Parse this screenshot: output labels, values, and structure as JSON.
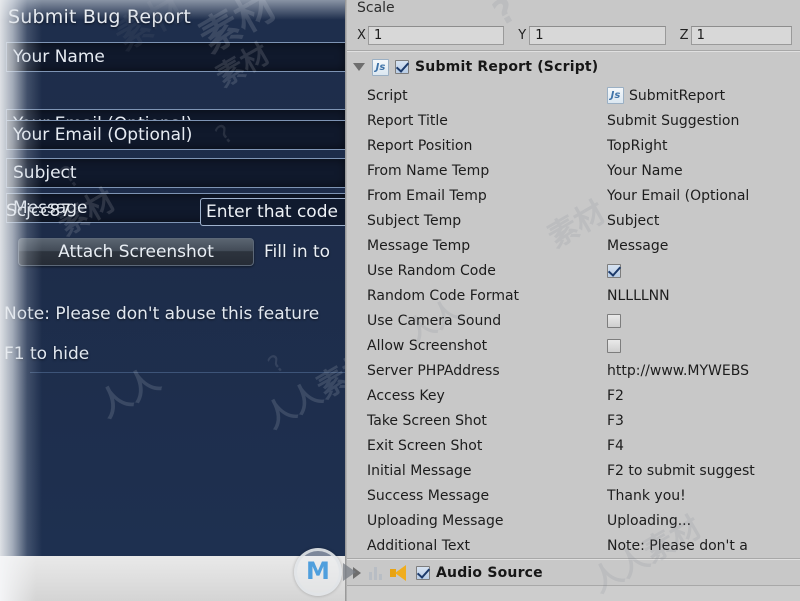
{
  "game_view": {
    "title": "Submit Bug Report",
    "fields": [
      {
        "name": "your-name",
        "value": "Your Name"
      },
      {
        "name": "your-email",
        "value": "Your Email (Optional)"
      },
      {
        "name": "subject",
        "value": "Subject"
      },
      {
        "name": "message",
        "value": "Message"
      }
    ],
    "captcha_code": "Scjcc87",
    "captcha_placeholder": "Enter that code",
    "attach_button": "Attach Screenshot",
    "fill_in_hint": "Fill in to",
    "note": "Note: Please don't abuse this feature",
    "hide_hint": "F1 to hide"
  },
  "inspector": {
    "scale_label": "Scale",
    "scale": {
      "x_axis": "X",
      "x_value": "1",
      "y_axis": "Y",
      "y_value": "1",
      "z_axis": "Z",
      "z_value": "1"
    },
    "component": {
      "icon": "js-script-icon",
      "enabled": true,
      "title": "Submit Report (Script)"
    },
    "properties": [
      {
        "label": "Script",
        "value": "SubmitReport",
        "type": "object",
        "icon": "js-script-icon"
      },
      {
        "label": "Report Title",
        "value": "Submit Suggestion",
        "type": "text"
      },
      {
        "label": "Report Position",
        "value": "TopRight",
        "type": "text"
      },
      {
        "label": "From Name Temp",
        "value": "Your Name",
        "type": "text"
      },
      {
        "label": "From Email Temp",
        "value": "Your Email (Optional",
        "type": "text"
      },
      {
        "label": "Subject Temp",
        "value": "Subject",
        "type": "text"
      },
      {
        "label": "Message Temp",
        "value": "Message",
        "type": "text"
      },
      {
        "label": "Use Random Code",
        "value": "",
        "type": "checkbox",
        "checked": true
      },
      {
        "label": "Random Code Format",
        "value": "NLLLLNN",
        "type": "text"
      },
      {
        "label": "Use Camera Sound",
        "value": "",
        "type": "checkbox",
        "checked": false
      },
      {
        "label": "Allow Screenshot",
        "value": "",
        "type": "checkbox",
        "checked": false
      },
      {
        "label": "Server PHPAddress",
        "value": "http://www.MYWEBS",
        "type": "text"
      },
      {
        "label": "Access Key",
        "value": "F2",
        "type": "text"
      },
      {
        "label": "Take Screen Shot",
        "value": "F3",
        "type": "text"
      },
      {
        "label": "Exit Screen Shot",
        "value": "F4",
        "type": "text"
      },
      {
        "label": "Initial Message",
        "value": "F2 to submit suggest",
        "type": "text"
      },
      {
        "label": "Success Message",
        "value": "Thank you!",
        "type": "text"
      },
      {
        "label": "Uploading Message",
        "value": "Uploading...",
        "type": "text"
      },
      {
        "label": "Additional Text",
        "value": "Note: Please don't a",
        "type": "text"
      }
    ],
    "audio_component": {
      "title": "Audio Source",
      "enabled": true,
      "icon": "speaker-icon"
    }
  },
  "watermark": {
    "logo_text": "M",
    "cjk_1": "素材",
    "cjk_2": "人人素材",
    "cjk_3": "素材",
    "cjk_4": "人人",
    "cjk_5": "素材",
    "circle_1": "?",
    "circle_2": "?"
  },
  "colors": {
    "game_bg": "#1e2e4c",
    "field_bg": "#10192c",
    "inspector_bg": "#c8c8c8",
    "accent": "#4f9fdd"
  }
}
